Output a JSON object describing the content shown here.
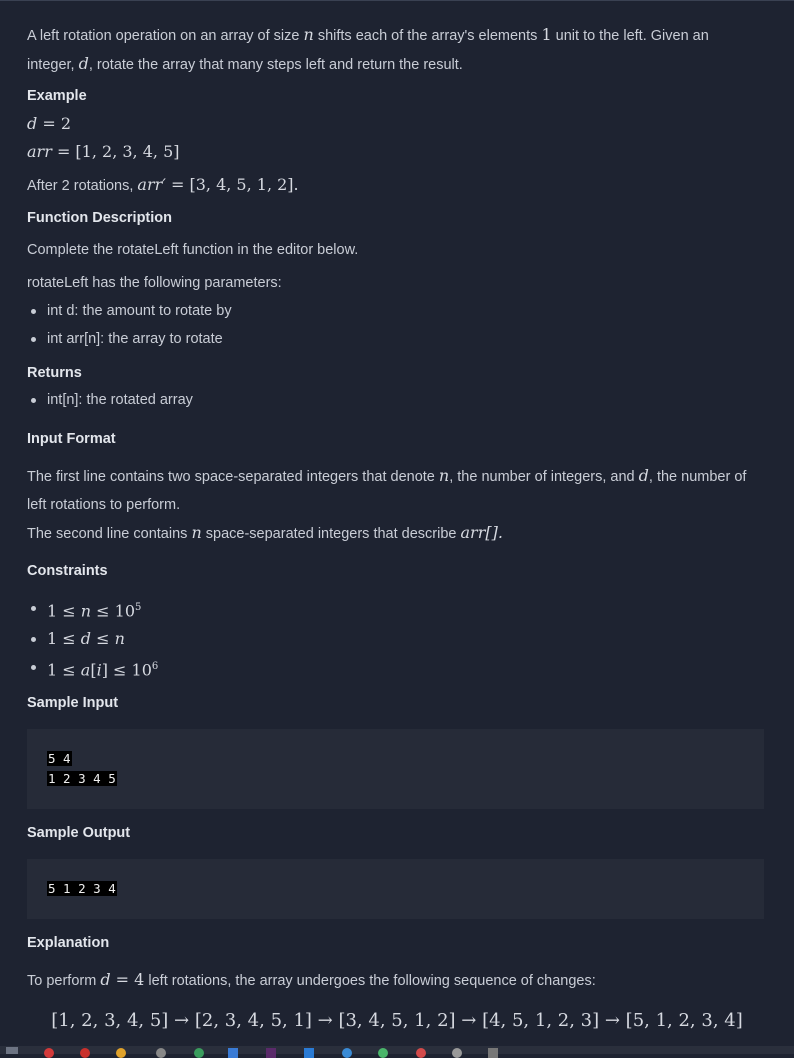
{
  "intro_line1": "A left rotation operation on an array of size",
  "intro_n": "n",
  "intro_line1b": "shifts each of the array's elements",
  "intro_one": "1",
  "intro_line1c": "unit to the left. Given an",
  "intro_line2a": "integer,",
  "intro_d": "d",
  "intro_line2b": ", rotate the array that many steps left and return the result.",
  "example_heading": "Example",
  "example_d": "d = 2",
  "example_arr_lhs": "arr",
  "example_arr_rhs": "= [1, 2, 3, 4, 5]",
  "after_text": "After 2 rotations,",
  "after_math": "arr′ = [3, 4, 5, 1, 2].",
  "func_heading": "Function Description",
  "func_text": "Complete the rotateLeft function in the editor below.",
  "params_text": "rotateLeft has the following parameters:",
  "params": [
    "int d: the amount to rotate by",
    "int arr[n]: the array to rotate"
  ],
  "returns_heading": "Returns",
  "returns": [
    "int[n]: the rotated array"
  ],
  "input_heading": "Input Format",
  "input_line1a": "The first line contains two space-separated integers that denote",
  "input_line1b": ", the number of integers, and",
  "input_line1c": ", the number of",
  "input_line2": "left rotations to perform.",
  "input_line3a": "The second line contains",
  "input_line3b": "space-separated integers that describe",
  "input_arr": "arr[].",
  "constraints_heading": "Constraints",
  "constraints": [
    "1 ≤ n ≤ 10⁵",
    "1 ≤ d ≤ n",
    "1 ≤ a[i] ≤ 10⁶"
  ],
  "sample_input_heading": "Sample Input",
  "sample_input_lines": [
    "5 4",
    "1 2 3 4 5"
  ],
  "sample_output_heading": "Sample Output",
  "sample_output_lines": [
    "5 1 2 3 4"
  ],
  "explanation_heading": "Explanation",
  "explanation_a": "To perform",
  "explanation_math": "d = 4",
  "explanation_b": "left rotations, the array undergoes the following sequence of changes:",
  "sequence": "[1, 2, 3, 4, 5] → [2, 3, 4, 5, 1] → [3, 4, 5, 1, 2] → [4, 5, 1, 2, 3] → [5, 1, 2, 3, 4]",
  "colors": {
    "background": "#1e2331",
    "codebox": "#262b38",
    "text": "#c9cdd6"
  }
}
